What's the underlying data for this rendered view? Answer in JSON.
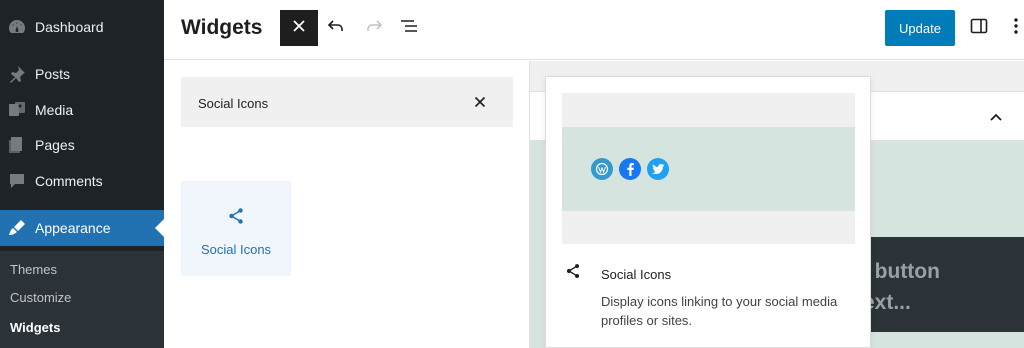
{
  "sidebar": {
    "items": [
      {
        "label": "Dashboard",
        "icon": "dashboard-icon"
      },
      {
        "label": "Posts",
        "icon": "pin-icon"
      },
      {
        "label": "Media",
        "icon": "media-icon"
      },
      {
        "label": "Pages",
        "icon": "pages-icon"
      },
      {
        "label": "Comments",
        "icon": "comment-icon"
      },
      {
        "label": "Appearance",
        "icon": "brush-icon",
        "active": true
      }
    ],
    "submenu": [
      {
        "label": "Themes"
      },
      {
        "label": "Customize"
      },
      {
        "label": "Widgets",
        "current": true
      }
    ]
  },
  "header": {
    "title": "Widgets",
    "update_label": "Update"
  },
  "inserter": {
    "search_value": "Social Icons",
    "results": [
      {
        "label": "Social Icons",
        "icon": "share-icon"
      }
    ]
  },
  "preview": {
    "title": "Social Icons",
    "description": "Display icons linking to your social media profiles or sites.",
    "icons": [
      {
        "name": "wordpress-icon",
        "color": "#3499cd"
      },
      {
        "name": "facebook-icon",
        "color": "#1778f2"
      },
      {
        "name": "twitter-icon",
        "color": "#1da1f2"
      }
    ]
  },
  "canvas": {
    "partial_text_1": "d button",
    "partial_text_2": "text..."
  },
  "colors": {
    "sidebar_bg": "#1d2327",
    "active_bg": "#2271b1",
    "primary": "#007cba",
    "canvas_green": "#d5e4df"
  }
}
